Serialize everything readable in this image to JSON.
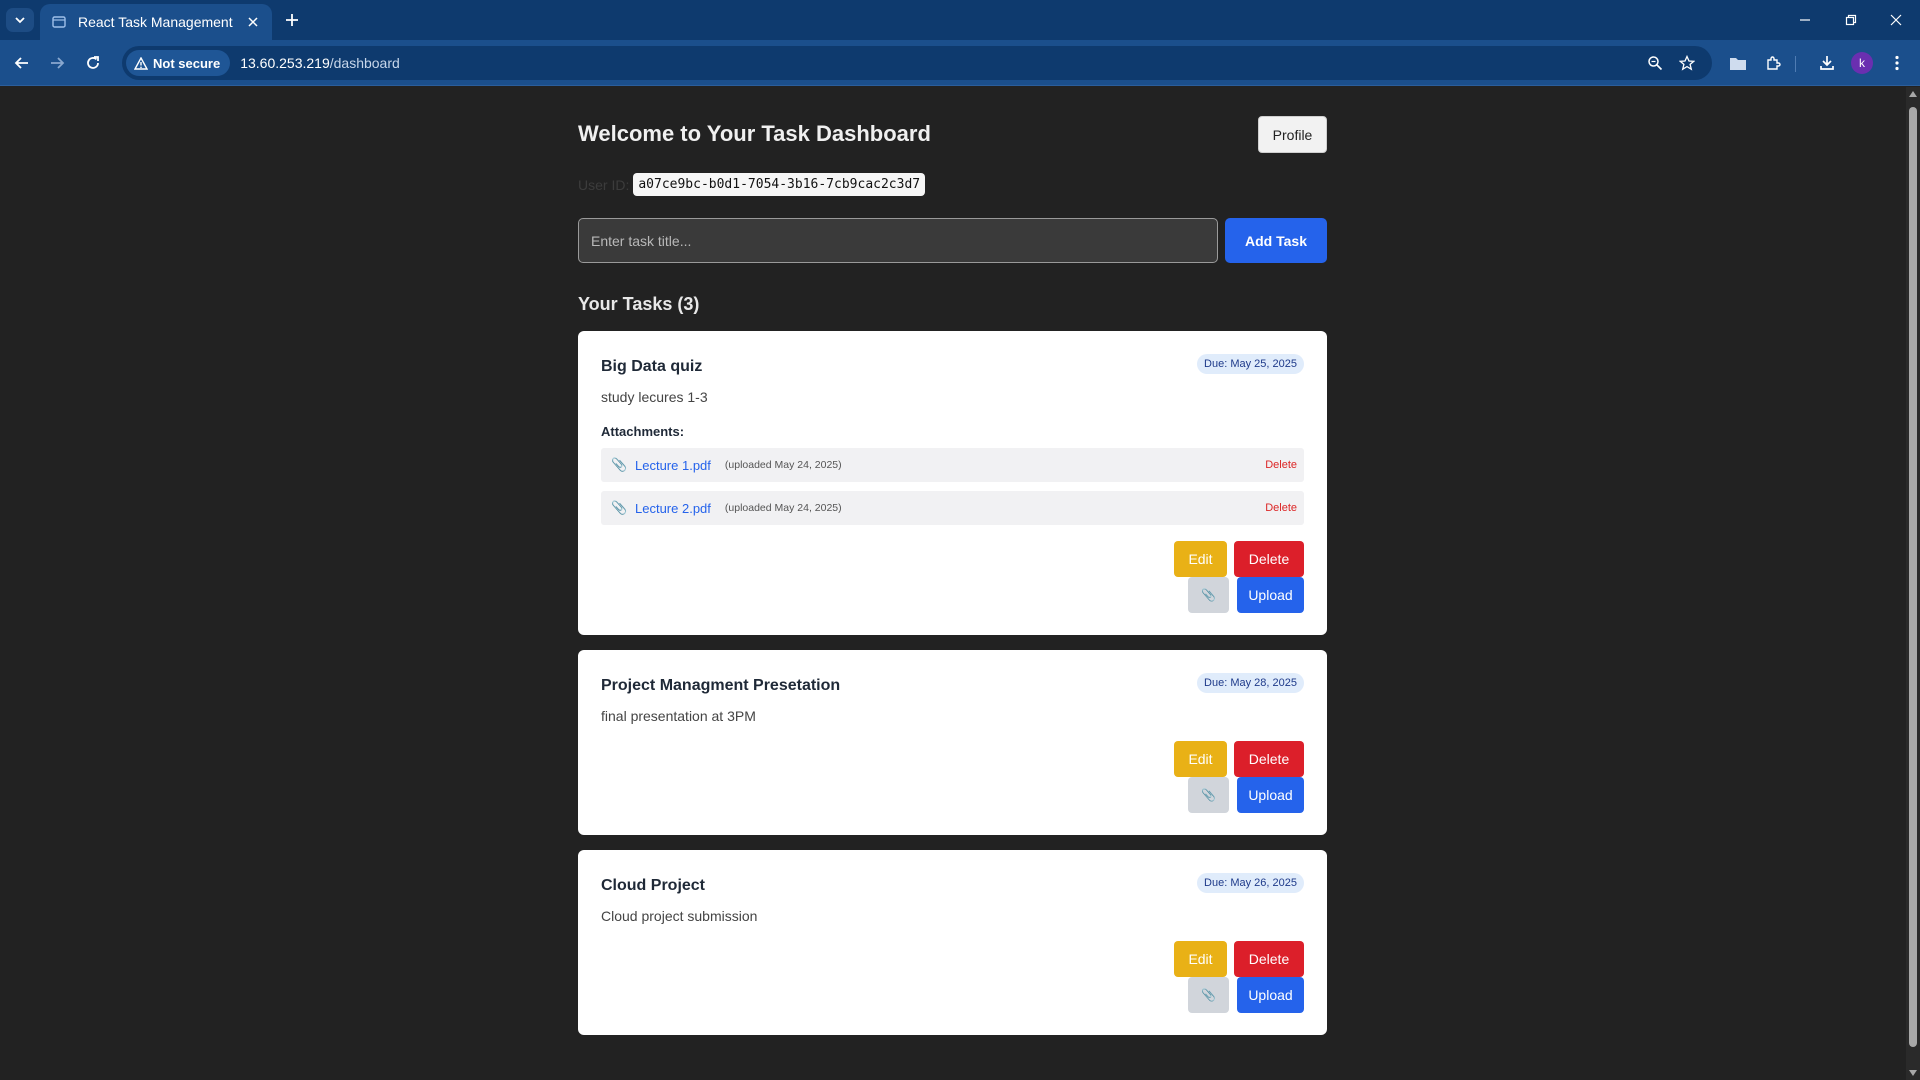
{
  "browser": {
    "tab_title": "React Task Management",
    "security_label": "Not secure",
    "url_host": "13.60.253.219",
    "url_path": "/dashboard",
    "profile_initial": "k"
  },
  "header": {
    "title": "Welcome to Your Task Dashboard",
    "profile_button": "Profile"
  },
  "user": {
    "id_label": "User ID:",
    "id_value": "a07ce9bc-b0d1-7054-3b16-7cb9cac2c3d7"
  },
  "add_task": {
    "placeholder": "Enter task title...",
    "button_label": "Add Task"
  },
  "tasks_section": {
    "title": "Your Tasks (3)"
  },
  "task_actions": {
    "edit": "Edit",
    "delete": "Delete",
    "file_icon": "paperclip-icon",
    "upload": "Upload"
  },
  "tasks": [
    {
      "title": "Big Data quiz",
      "due": "Due: May 25, 2025",
      "description": "study lecures 1-3",
      "attachments_label": "Attachments:",
      "attachments": [
        {
          "name": "Lecture 1.pdf",
          "uploaded": "(uploaded May 24, 2025)",
          "delete": "Delete"
        },
        {
          "name": "Lecture 2.pdf",
          "uploaded": "(uploaded May 24, 2025)",
          "delete": "Delete"
        }
      ]
    },
    {
      "title": "Project Managment Presetation",
      "due": "Due: May 28, 2025",
      "description": "final presentation at 3PM"
    },
    {
      "title": "Cloud Project",
      "due": "Due: May 26, 2025",
      "description": "Cloud project submission"
    }
  ],
  "colors": {
    "primary": "#2563eb",
    "edit": "#e9b116",
    "delete": "#dc1f2a",
    "page_bg": "#222222",
    "chrome_bg": "#1b4f8c"
  }
}
